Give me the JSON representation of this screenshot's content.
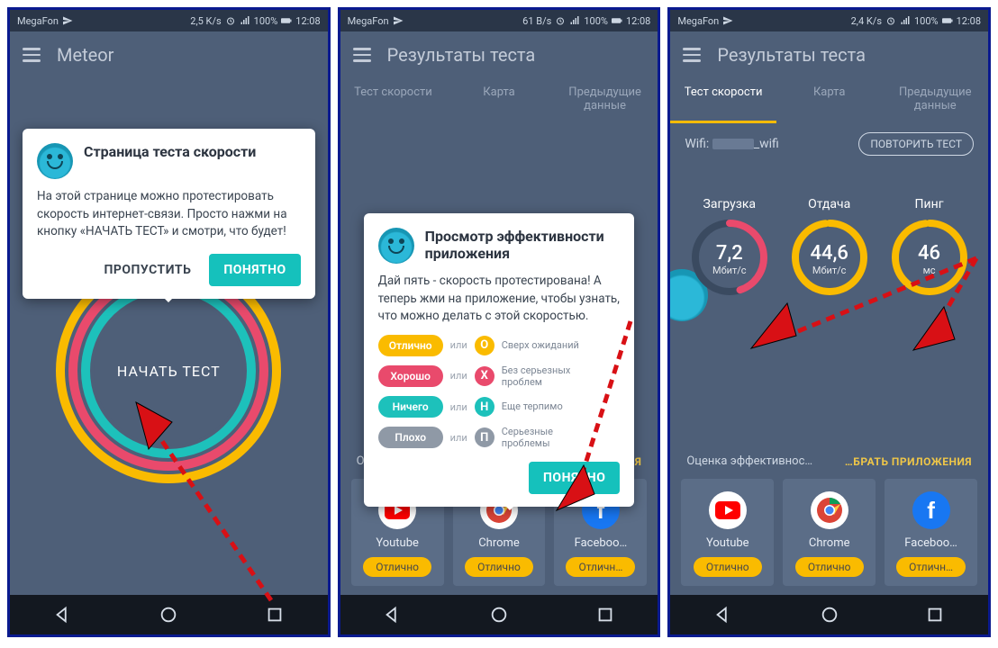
{
  "status": {
    "carrier": "MegaFon",
    "speeds": [
      "2,5 K/s",
      "61 B/s",
      "2,4 K/s"
    ],
    "battery": "100%",
    "time": "12:08"
  },
  "screen1": {
    "title": "Meteor",
    "popover": {
      "heading": "Страница теста скорости",
      "body": "На этой странице можно протестировать скорость интернет-связи. Просто нажми на кнопку «НАЧАТЬ ТЕСТ» и смотри, что будет!",
      "skip": "ПРОПУСТИТЬ",
      "ok": "ПОНЯТНО"
    },
    "start_label": "НАЧАТЬ ТЕСТ"
  },
  "screen2": {
    "title": "Результаты теста",
    "tabs": [
      "Тест скорости",
      "Карта",
      "Предыдущие данные"
    ],
    "popover": {
      "heading": "Просмотр эффективности приложения",
      "body": "Дай пять - скорость протестирована! А теперь жми на приложение, чтобы узнать, что можно делать с этой скоростью.",
      "legend": {
        "rows": [
          {
            "pill": "Отлично",
            "col": "#fabb00",
            "letter": "О",
            "desc": "Сверх ожиданий"
          },
          {
            "pill": "Хорошо",
            "col": "#e94a6c",
            "letter": "Х",
            "desc": "Без серьезных проблем"
          },
          {
            "pill": "Ничего",
            "col": "#1dc1bb",
            "letter": "Н",
            "desc": "Еще терпимо"
          },
          {
            "pill": "Плохо",
            "col": "#8f99a6",
            "letter": "П",
            "desc": "Серьезные проблемы"
          }
        ],
        "sep": "или"
      },
      "ok": "ПОНЯТНО"
    },
    "eval_label": "Оценка эффективн…",
    "pick_apps": "…БРАТЬ ПРИЛОЖЕНИЯ",
    "apps": [
      {
        "name": "Youtube",
        "score": "Отлично"
      },
      {
        "name": "Chrome",
        "score": "Отлично"
      },
      {
        "name": "Faceboo…",
        "score": "Отличн…"
      }
    ]
  },
  "screen3": {
    "title": "Результаты теста",
    "tabs": [
      "Тест скорости",
      "Карта",
      "Предыдущие данные"
    ],
    "wifi_label": "Wifi:",
    "wifi_name": "_wifi",
    "retest": "ПОВТОРИТЬ ТЕСТ",
    "metrics": [
      {
        "label": "Загрузка",
        "value": "7,2",
        "unit": "Мбит/с",
        "color": "#e94a6c",
        "frac": 0.45
      },
      {
        "label": "Отдача",
        "value": "44,6",
        "unit": "Мбит/с",
        "color": "#fabb00",
        "frac": 0.98
      },
      {
        "label": "Пинг",
        "value": "46",
        "unit": "мс",
        "color": "#fabb00",
        "frac": 0.98
      }
    ],
    "eval_label": "Оценка эффективнос…",
    "pick_apps": "…БРАТЬ ПРИЛОЖЕНИЯ",
    "apps": [
      {
        "name": "Youtube",
        "score": "Отлично"
      },
      {
        "name": "Chrome",
        "score": "Отлично"
      },
      {
        "name": "Faceboo…",
        "score": "Отличн…"
      }
    ]
  }
}
